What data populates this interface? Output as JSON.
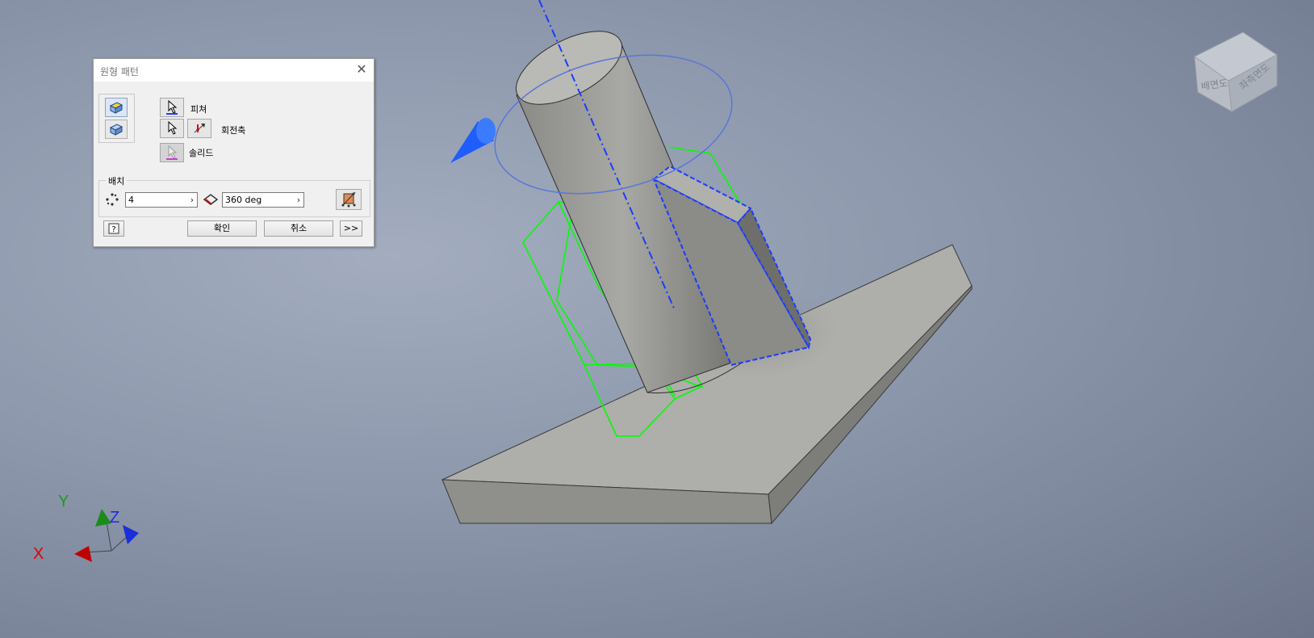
{
  "dialog": {
    "title": "원형 패턴",
    "features_label": "피쳐",
    "rotation_axis_label": "회전축",
    "solid_label": "솔리드",
    "placement_label": "배치",
    "count_value": "4",
    "angle_value": "360 deg",
    "ok_label": "확인",
    "cancel_label": "취소",
    "more_label": ">>"
  },
  "viewcube": {
    "face_front": "배면도",
    "face_side": "좌측면도"
  },
  "triad": {
    "x": "X",
    "y": "Y",
    "z": "Z"
  },
  "colors": {
    "preview_green": "#00ff00",
    "selection_blue": "#1a3cff",
    "axis_x": "#e00000",
    "axis_y": "#1b9c1b",
    "axis_z": "#1a2fd8"
  }
}
